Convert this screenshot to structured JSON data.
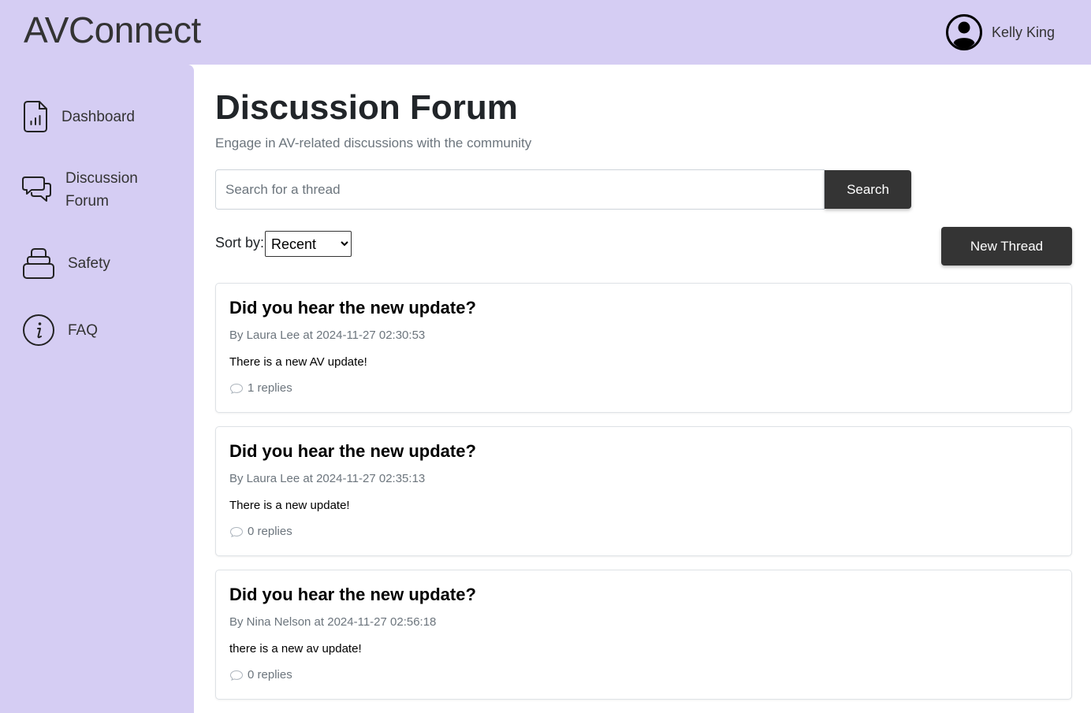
{
  "app": {
    "brand": "AVConnect"
  },
  "user": {
    "name": "Kelly King",
    "avatar_icon": "user-circle-icon"
  },
  "sidebar": {
    "items": [
      {
        "label": "Dashboard",
        "icon": "document-chart-icon"
      },
      {
        "label_line1": "Discussion",
        "label_line2": "Forum",
        "icon": "chat-bubbles-icon"
      },
      {
        "label": "Safety",
        "icon": "luggage-stack-icon"
      },
      {
        "label": "FAQ",
        "icon": "info-circle-icon"
      }
    ]
  },
  "page": {
    "title": "Discussion Forum",
    "subtitle": "Engage in AV-related discussions with the community"
  },
  "search": {
    "placeholder": "Search for a thread",
    "value": "",
    "button_label": "Search"
  },
  "sort": {
    "label": "Sort by:",
    "selected": "Recent"
  },
  "new_thread_label": "New Thread",
  "threads": [
    {
      "title": "Did you hear the new update?",
      "meta": "By Laura Lee at 2024-11-27 02:30:53",
      "body": "There is a new AV update!",
      "replies": "1 replies"
    },
    {
      "title": "Did you hear the new update?",
      "meta": "By Laura Lee at 2024-11-27 02:35:13",
      "body": "There is a new update!",
      "replies": "0 replies"
    },
    {
      "title": "Did you hear the new update?",
      "meta": "By Nina Nelson at 2024-11-27 02:56:18",
      "body": "there is a new av update!",
      "replies": "0 replies"
    }
  ]
}
